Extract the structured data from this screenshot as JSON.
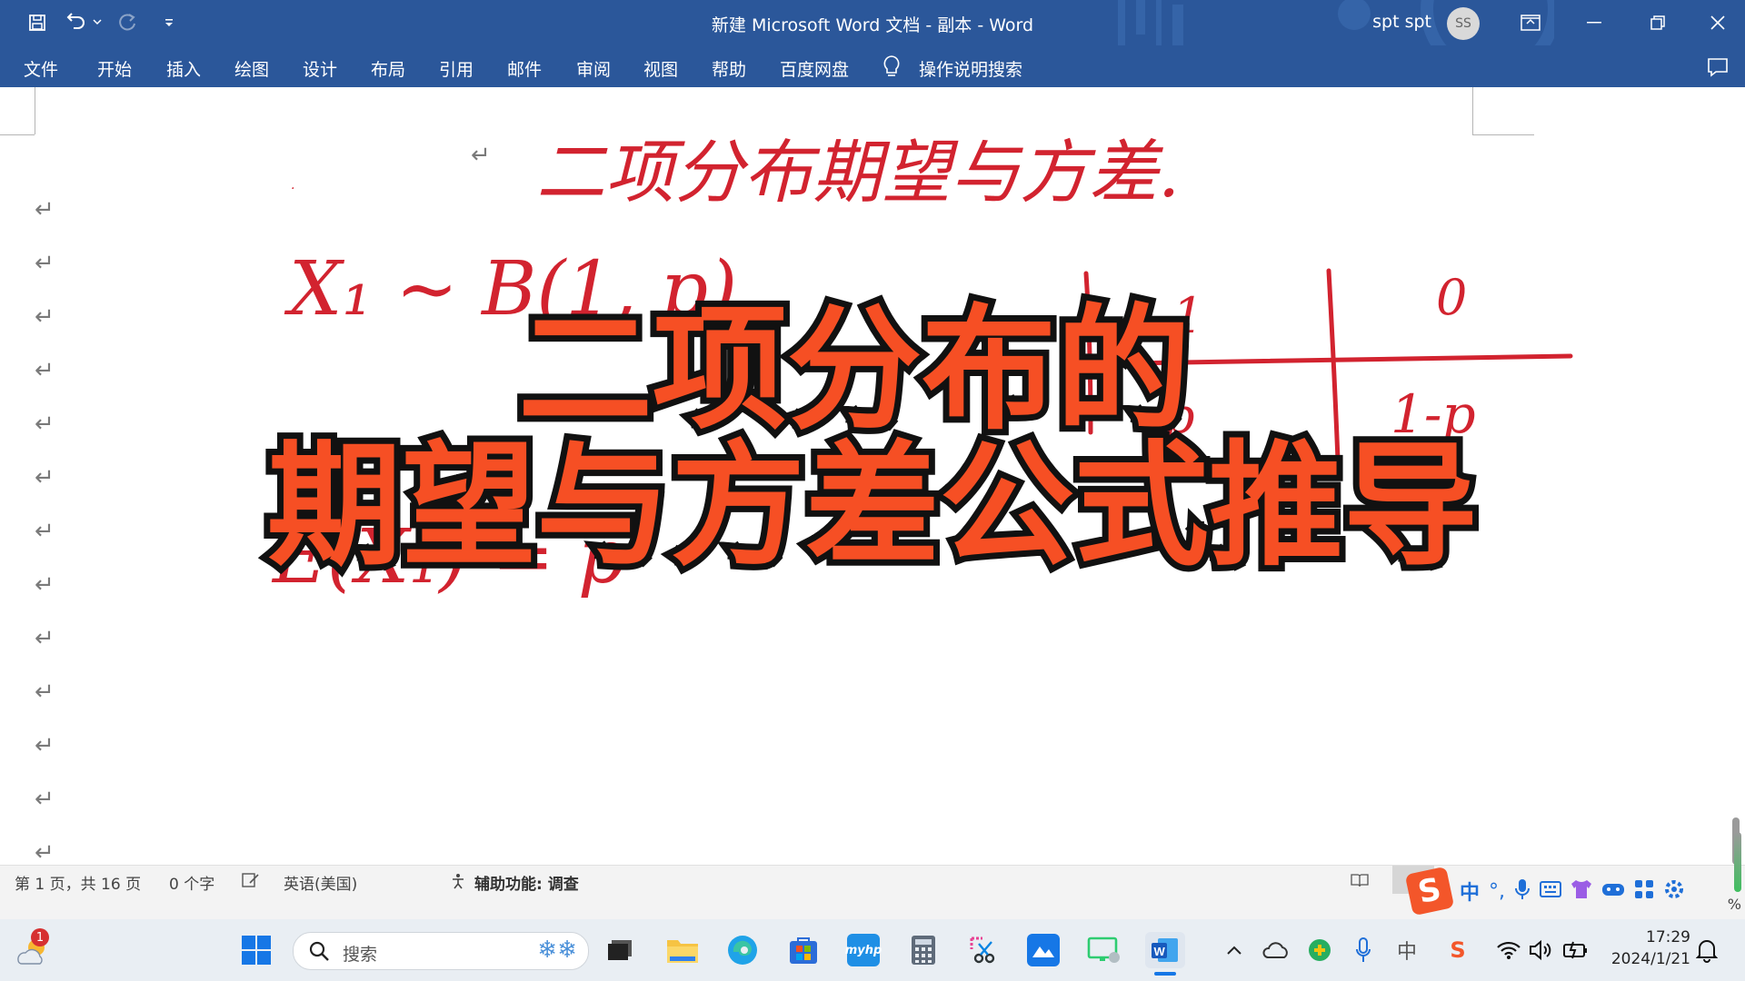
{
  "window": {
    "title": "新建 Microsoft Word 文档 - 副本  -  Word",
    "user_name": "spt spt",
    "avatar_initials": "SS"
  },
  "ribbon": {
    "tabs": [
      "文件",
      "开始",
      "插入",
      "绘图",
      "设计",
      "布局",
      "引用",
      "邮件",
      "审阅",
      "视图",
      "帮助",
      "百度网盘"
    ],
    "tell_me": "操作说明搜索"
  },
  "document": {
    "paragraph_mark": "↵",
    "handwriting": {
      "heading": "二项分布期望与方差.",
      "line1": "X₁ ~ B(1, p)",
      "table_top": [
        "1",
        "0"
      ],
      "table_bottom": [
        "p",
        "1-p"
      ],
      "line2": "E(X₁) = p"
    },
    "overlay_title": {
      "line1": "二项分布的",
      "line2": "期望与方差公式推导",
      "fill_color": "#f64f24",
      "stroke_color": "#111111"
    },
    "ink_color": "#d2232f"
  },
  "status_bar": {
    "page_info": "第 1 页，共 16 页",
    "word_count": "0 个字",
    "language": "英语(美国)",
    "accessibility": "辅助功能: 调查"
  },
  "taskbar": {
    "search_placeholder": "搜索",
    "notification_badge": "1",
    "ime_label": "中",
    "time": "17:29",
    "date": "2024/1/21"
  },
  "colors": {
    "accent": "#2b579a",
    "taskbar": "#e9eef3"
  }
}
